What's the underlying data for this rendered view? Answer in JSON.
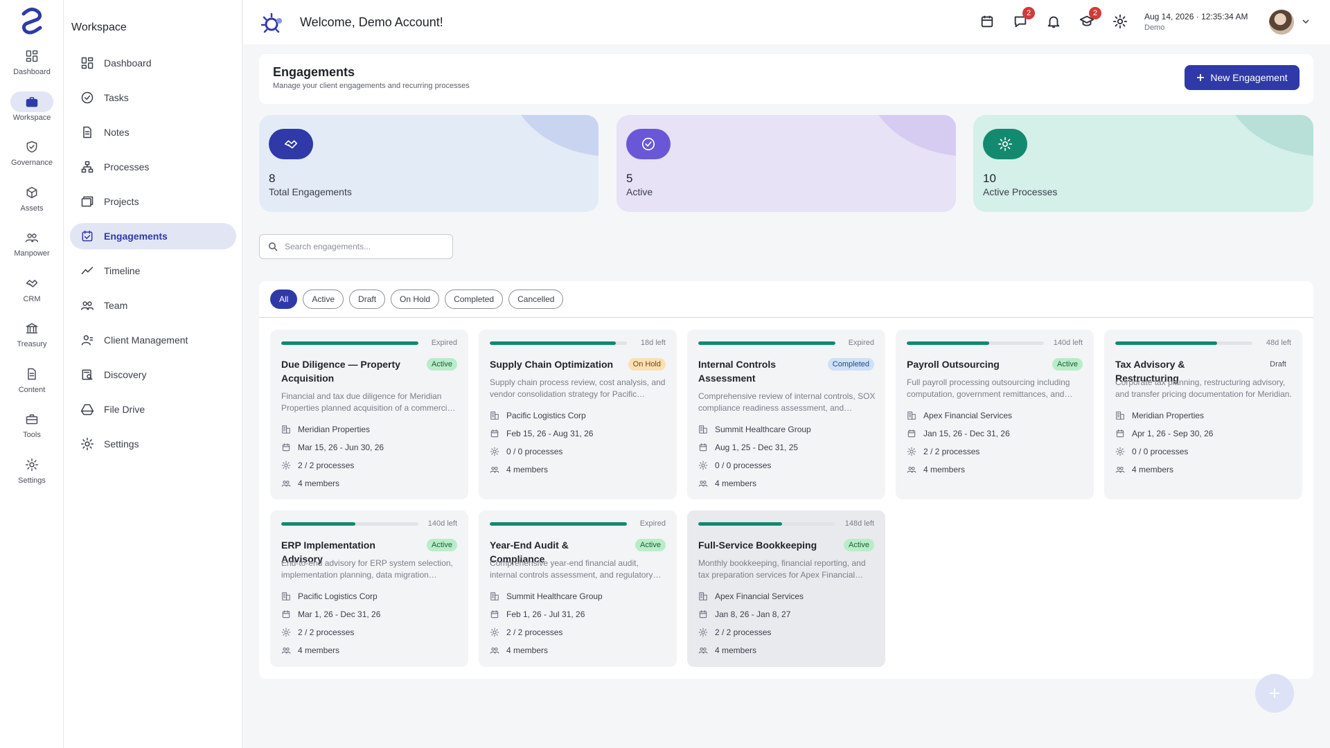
{
  "rail": {
    "items": [
      {
        "label": "Dashboard",
        "icon": "dashboard-icon"
      },
      {
        "label": "Workspace",
        "icon": "briefcase-icon"
      },
      {
        "label": "Governance",
        "icon": "shield-icon"
      },
      {
        "label": "Assets",
        "icon": "cube-icon"
      },
      {
        "label": "Manpower",
        "icon": "people-icon"
      },
      {
        "label": "CRM",
        "icon": "handshake-icon"
      },
      {
        "label": "Treasury",
        "icon": "bank-icon"
      },
      {
        "label": "Content",
        "icon": "document-icon"
      },
      {
        "label": "Tools",
        "icon": "toolbox-icon"
      },
      {
        "label": "Settings",
        "icon": "gear-icon"
      }
    ]
  },
  "sidebar": {
    "title": "Workspace",
    "items": [
      {
        "label": "Dashboard"
      },
      {
        "label": "Tasks"
      },
      {
        "label": "Notes"
      },
      {
        "label": "Processes"
      },
      {
        "label": "Projects"
      },
      {
        "label": "Engagements"
      },
      {
        "label": "Timeline"
      },
      {
        "label": "Team"
      },
      {
        "label": "Client Management"
      },
      {
        "label": "Discovery"
      },
      {
        "label": "File Drive"
      },
      {
        "label": "Settings"
      }
    ]
  },
  "header": {
    "welcome": "Welcome, Demo Account!",
    "messages_badge": "2",
    "courses_badge": "2",
    "date": "Aug 14, 2026",
    "time": "12:35:34 AM",
    "user_sub": "Demo"
  },
  "page": {
    "title": "Engagements",
    "subtitle": "Manage your client engagements and recurring processes",
    "new_button": "New Engagement",
    "search_placeholder": "Search engagements..."
  },
  "stats": [
    {
      "value": "8",
      "label": "Total Engagements",
      "bg": "#e3ebf7",
      "icon_bg": "#2f3aa8",
      "deco": "#c9d4f0"
    },
    {
      "value": "5",
      "label": "Active",
      "bg": "#e7e2f6",
      "icon_bg": "#6a57d8",
      "deco": "#d6ccf2"
    },
    {
      "value": "10",
      "label": "Active Processes",
      "bg": "#d5efe9",
      "icon_bg": "#138a6f",
      "deco": "#b8e0d8"
    }
  ],
  "filters": [
    "All",
    "Active",
    "Draft",
    "On Hold",
    "Completed",
    "Cancelled"
  ],
  "engagements": [
    {
      "title": "Due Diligence — Property Acquisition",
      "status": "Active",
      "days": "Expired",
      "progress": 1.0,
      "desc": "Financial and tax due diligence for Meridian Properties planned acquisition of a commercial property.",
      "client": "Meridian Properties",
      "dates": "Mar 15, 26 - Jun 30, 26",
      "processes": "2 / 2 processes",
      "members": "4 members"
    },
    {
      "title": "Supply Chain Optimization",
      "status": "On Hold",
      "days": "18d left",
      "progress": 0.92,
      "desc": "Supply chain process review, cost analysis, and vendor consolidation strategy for Pacific Logistics.",
      "client": "Pacific Logistics Corp",
      "dates": "Feb 15, 26 - Aug 31, 26",
      "processes": "0 / 0 processes",
      "members": "4 members"
    },
    {
      "title": "Internal Controls Assessment",
      "status": "Completed",
      "days": "Expired",
      "progress": 1.0,
      "desc": "Comprehensive review of internal controls, SOX compliance readiness assessment, and remediation.",
      "client": "Summit Healthcare Group",
      "dates": "Aug 1, 25 - Dec 31, 25",
      "processes": "0 / 0 processes",
      "members": "4 members"
    },
    {
      "title": "Payroll Outsourcing",
      "status": "Active",
      "days": "140d left",
      "progress": 0.6,
      "desc": "Full payroll processing outsourcing including computation, government remittances, and reporting.",
      "client": "Apex Financial Services",
      "dates": "Jan 15, 26 - Dec 31, 26",
      "processes": "2 / 2 processes",
      "members": "4 members"
    },
    {
      "title": "Tax Advisory & Restructuring",
      "status": "Draft",
      "days": "48d left",
      "progress": 0.74,
      "desc": "Corporate tax planning, restructuring advisory, and transfer pricing documentation for Meridian.",
      "client": "Meridian Properties",
      "dates": "Apr 1, 26 - Sep 30, 26",
      "processes": "0 / 0 processes",
      "members": "4 members"
    },
    {
      "title": "ERP Implementation Advisory",
      "status": "Active",
      "days": "140d left",
      "progress": 0.54,
      "desc": "End-to-end advisory for ERP system selection, implementation planning, data migration oversight.",
      "client": "Pacific Logistics Corp",
      "dates": "Mar 1, 26 - Dec 31, 26",
      "processes": "2 / 2 processes",
      "members": "4 members"
    },
    {
      "title": "Year-End Audit & Compliance",
      "status": "Active",
      "days": "Expired",
      "progress": 1.0,
      "desc": "Comprehensive year-end financial audit, internal controls assessment, and regulatory filings.",
      "client": "Summit Healthcare Group",
      "dates": "Feb 1, 26 - Jul 31, 26",
      "processes": "2 / 2 processes",
      "members": "4 members"
    },
    {
      "title": "Full-Service Bookkeeping",
      "status": "Active",
      "days": "148d left",
      "progress": 0.61,
      "desc": "Monthly bookkeeping, financial reporting, and tax preparation services for Apex Financial Services.",
      "client": "Apex Financial Services",
      "dates": "Jan 8, 26 - Jan 8, 27",
      "processes": "2 / 2 processes",
      "members": "4 members"
    }
  ]
}
